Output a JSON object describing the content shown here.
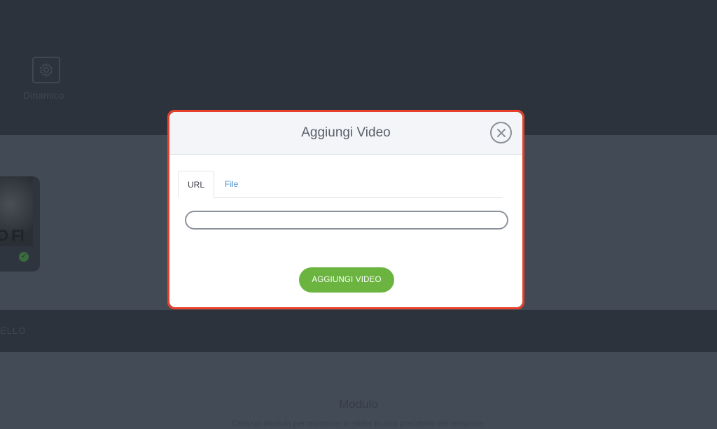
{
  "background": {
    "header": {
      "dinamico_label": "Dinamico"
    },
    "card": {
      "text": "O Fl"
    },
    "strip": {
      "label": "ELLO"
    },
    "lower": {
      "title": "Modulo",
      "description": "Crea un modulo per mostrare lo slider in una posizione del template."
    }
  },
  "modal": {
    "title": "Aggiungi Video",
    "close_icon": "close-icon",
    "tabs": [
      {
        "label": "URL",
        "active": true
      },
      {
        "label": "File",
        "active": false
      }
    ],
    "url_input": {
      "value": "",
      "placeholder": ""
    },
    "submit_label": "AGGIUNGI VIDEO"
  },
  "colors": {
    "accent_green": "#6ab43f",
    "link_blue": "#4a90c9",
    "highlight_red": "#e8402a",
    "overlay_dark": "#2d333d"
  }
}
